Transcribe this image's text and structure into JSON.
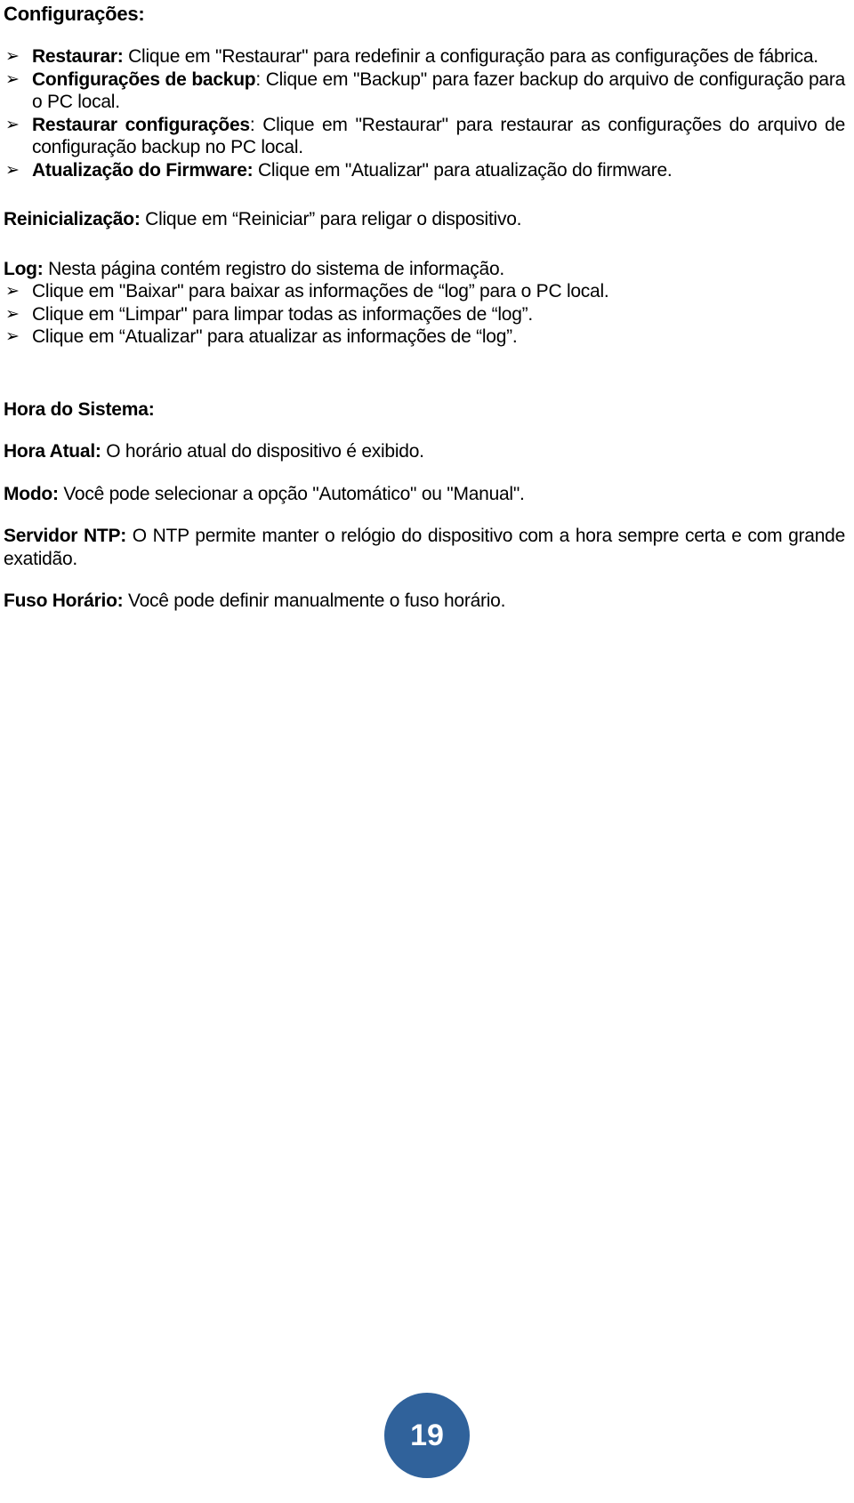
{
  "document": {
    "title": "Configurações:",
    "page_number": "19",
    "page_badge_color": "#30629B",
    "text_color": "#000000"
  },
  "settings_section": {
    "heading": "Configurações:",
    "bullets": [
      {
        "marker": "➢",
        "label": "Restaurar:",
        "text": " Clique em \"Restaurar\" para redefinir a configuração para as configurações de fábrica."
      },
      {
        "marker": "➢",
        "label": "Configurações de backup",
        "text": ": Clique em \"Backup\" para fazer backup do arquivo de configuração para o PC local."
      },
      {
        "marker": "➢",
        "label": "Restaurar configurações",
        "text": ": Clique em \"Restaurar\" para restaurar as configurações do arquivo de configuração backup no PC local."
      },
      {
        "marker": "➢",
        "label": "Atualização do Firmware:",
        "text": " Clique em \"Atualizar\" para atualização do firmware."
      }
    ]
  },
  "reboot_section": {
    "label": "Reinicialização:",
    "text": " Clique em “Reiniciar” para religar o dispositivo."
  },
  "log_section": {
    "label": "Log:",
    "text": " Nesta página contém registro do sistema de informação.",
    "bullets": [
      {
        "marker": "➢",
        "text": "Clique em \"Baixar\" para baixar as informações de “log” para o PC local."
      },
      {
        "marker": "➢",
        "text": "Clique em “Limpar\" para limpar todas as informações de “log”."
      },
      {
        "marker": "➢",
        "text": "Clique em “Atualizar\" para atualizar as informações de “log”."
      }
    ]
  },
  "system_time_section": {
    "heading": "Hora do Sistema:",
    "entries": [
      {
        "label": "Hora Atual:",
        "text": " O horário atual do dispositivo é exibido."
      },
      {
        "label": "Modo:",
        "text": " Você pode selecionar a opção \"Automático\" ou \"Manual\"."
      },
      {
        "label": "Servidor NTP:",
        "text": " O NTP permite manter o relógio do dispositivo com a hora sempre certa e com grande exatidão."
      },
      {
        "label": "Fuso Horário:",
        "text": " Você pode definir manualmente o fuso horário."
      }
    ]
  }
}
